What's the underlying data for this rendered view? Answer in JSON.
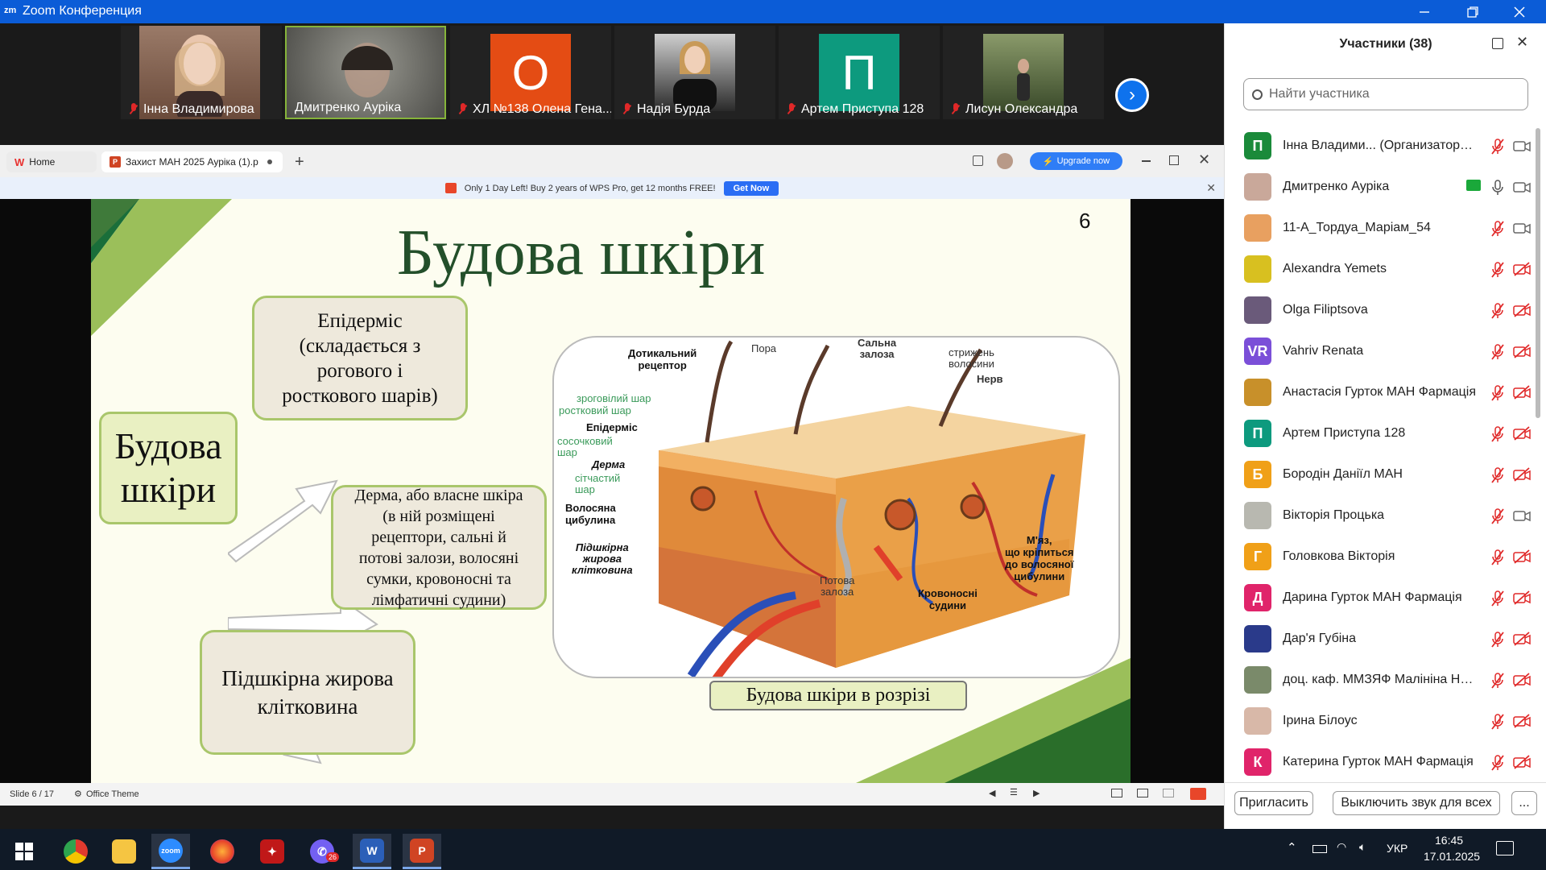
{
  "window": {
    "title": "Zoom Конференция",
    "logo": "zm"
  },
  "gallery": [
    {
      "name": "Інна Владимирова",
      "type": "photo",
      "bg": "#8a6a5a"
    },
    {
      "name": "Дмитренко Аурiка",
      "type": "photo",
      "bg": "#6a6a66"
    },
    {
      "name": "ХЛ №138 Олена Гена...",
      "type": "letter",
      "letter": "О",
      "bg": "#e44c14"
    },
    {
      "name": "Надія Бурда",
      "type": "photo",
      "bg": "#3a3a3a"
    },
    {
      "name": "Артем Приступа 128",
      "type": "letter",
      "letter": "П",
      "bg": "#0d9a7e"
    },
    {
      "name": "Лисун Олександра",
      "type": "photo",
      "bg": "#4c6a3a"
    }
  ],
  "wps": {
    "tabs": [
      {
        "label": "Home"
      },
      {
        "label": "Захист МАН 2025 Аурiка (1).p"
      }
    ],
    "upgrade": "Upgrade now",
    "notice": "Only 1 Day Left! Buy 2 years of WPS Pro, get 12 months FREE!",
    "get_now": "Get Now",
    "slide_status": "Slide 6 / 17",
    "theme": "Office Theme"
  },
  "slide": {
    "number": "6",
    "title": "Будова шкіри",
    "center_box": [
      "Будова",
      "шкіри"
    ],
    "box_epidermis": [
      "Епідерміс",
      "(складається з",
      "рогового і",
      "росткового шарів)"
    ],
    "box_derma": [
      "Дерма, або власне шкіра",
      "(в ній розміщені",
      "рецептори, сальні й",
      "потові залози, волосяні",
      "сумки, кровоносні та",
      "лімфатичні судини)"
    ],
    "box_hypo": [
      "Підшкірна жирова",
      "клітковина"
    ],
    "caption": "Будова шкіри в розрізі",
    "diagram_labels": {
      "receptor": [
        "Дотикальний",
        "рецептор"
      ],
      "pora": "Пора",
      "salna": [
        "Сальна",
        "залоза"
      ],
      "hair_shaft": [
        "стрижень",
        "волосини"
      ],
      "nerve": "Нерв",
      "horny": "зроговілий шар",
      "growth": "ростковий шар",
      "epidermis": "Епідерміс",
      "papillary": [
        "сосочковий",
        "шар"
      ],
      "derma": "Дерма",
      "reticular": [
        "сітчастий",
        "шар"
      ],
      "bulb": [
        "Волосяна",
        "цибулина"
      ],
      "hypo": [
        "Підшкірна",
        "жирова",
        "клітковина"
      ],
      "sweat": [
        "Потова",
        "залоза"
      ],
      "muscle": [
        "М'яз,",
        "що кріпиться",
        "до волосяної",
        "цибулини"
      ],
      "vessels": [
        "Кровоносні",
        "судини"
      ]
    }
  },
  "panel": {
    "title": "Участники (38)",
    "search_placeholder": "Найти участника",
    "participants": [
      {
        "name": "Інна Владими...   (Организатор, я)",
        "avatar": "П",
        "color": "#1a8a3a",
        "mic": "muted",
        "video": "on"
      },
      {
        "name": "Дмитренко Аурiка",
        "avatar": "",
        "color": "#c9a89a",
        "mic": "on",
        "video": "on",
        "share": true
      },
      {
        "name": "11-А_Тордуа_Маріам_54",
        "avatar": "",
        "color": "#e8a060",
        "mic": "muted",
        "video": "on"
      },
      {
        "name": "Alexandra Yemets",
        "avatar": "",
        "color": "#d8c020",
        "mic": "muted",
        "video": "off"
      },
      {
        "name": "Olga Filiptsova",
        "avatar": "",
        "color": "#6a5a7a",
        "mic": "muted",
        "video": "off"
      },
      {
        "name": "Vahriv Renata",
        "avatar": "VR",
        "color": "#7b4fd8",
        "mic": "muted",
        "video": "off"
      },
      {
        "name": "Анастасія Гуртoк МАН Фармація",
        "avatar": "",
        "color": "#c8902a",
        "mic": "muted",
        "video": "off"
      },
      {
        "name": "Артем Приступа 128",
        "avatar": "П",
        "color": "#0d9a7e",
        "mic": "muted",
        "video": "off"
      },
      {
        "name": "Бородін Даніїл МАН",
        "avatar": "Б",
        "color": "#f0a018",
        "mic": "muted",
        "video": "off"
      },
      {
        "name": "Вікторія Процька",
        "avatar": "",
        "color": "#b8b8b0",
        "mic": "muted",
        "video": "on"
      },
      {
        "name": "Головкова Вікторія",
        "avatar": "Г",
        "color": "#f0a018",
        "mic": "muted",
        "video": "off"
      },
      {
        "name": "Дарина Гуртoк МАН Фармація",
        "avatar": "Д",
        "color": "#e0246a",
        "mic": "muted",
        "video": "off"
      },
      {
        "name": "Дар'я Губіна",
        "avatar": "",
        "color": "#2a3a8a",
        "mic": "muted",
        "video": "off"
      },
      {
        "name": "доц. каф. ММЗЯФ Малініна Нат...",
        "avatar": "",
        "color": "#7a8a6a",
        "mic": "muted",
        "video": "off"
      },
      {
        "name": "Ірина Білоус",
        "avatar": "",
        "color": "#d8b8a8",
        "mic": "muted",
        "video": "off"
      },
      {
        "name": "Катерина Гуртoк МАН Фармація",
        "avatar": "К",
        "color": "#e0246a",
        "mic": "muted",
        "video": "off"
      }
    ],
    "invite": "Пригласить",
    "mute_all": "Выключить звук для всех",
    "more": "..."
  },
  "taskbar": {
    "lang": "УКР",
    "time": "16:45",
    "date": "17.01.2025",
    "viber_badge": "26"
  }
}
